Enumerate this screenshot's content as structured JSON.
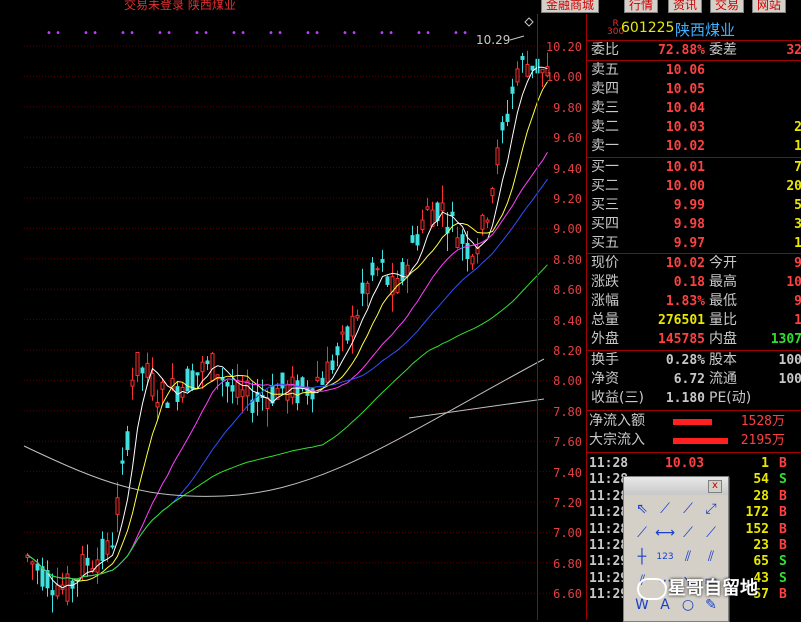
{
  "topbar": {
    "status_text": "交易未登录  陕西煤业",
    "buttons": [
      "金融商城",
      "行情",
      "资讯",
      "交易",
      "网站"
    ]
  },
  "chart": {
    "price_axis": [
      "10.20",
      "10.00",
      "9.80",
      "9.60",
      "9.40",
      "9.20",
      "9.00",
      "8.80",
      "8.60",
      "8.40",
      "8.20",
      "8.00",
      "7.80",
      "7.60",
      "7.40",
      "7.20",
      "7.00",
      "6.80",
      "6.60"
    ],
    "high_marker": "10.29",
    "colors": {
      "up": "#ff3030",
      "down": "#40e0e0",
      "ma5": "#ffffff",
      "ma10": "#ffff40",
      "ma20": "#ff40ff",
      "ma30": "#3050ff",
      "ma60": "#30e030",
      "ma120": "#c0c0c0"
    }
  },
  "quote": {
    "badge_r": "R",
    "badge_300": "300",
    "code": "601225",
    "name": "陕西煤业",
    "wei_bi_label": "委比",
    "wei_bi": "72.88%",
    "wei_cha_label": "委差",
    "wei_cha": "32",
    "asks": [
      {
        "label": "卖五",
        "price": "10.06",
        "vol": ""
      },
      {
        "label": "卖四",
        "price": "10.05",
        "vol": ""
      },
      {
        "label": "卖三",
        "price": "10.04",
        "vol": ""
      },
      {
        "label": "卖二",
        "price": "10.03",
        "vol": "2"
      },
      {
        "label": "卖一",
        "price": "10.02",
        "vol": "1"
      }
    ],
    "bids": [
      {
        "label": "买一",
        "price": "10.01",
        "vol": "7"
      },
      {
        "label": "买二",
        "price": "10.00",
        "vol": "20"
      },
      {
        "label": "买三",
        "price": "9.99",
        "vol": "5"
      },
      {
        "label": "买四",
        "price": "9.98",
        "vol": "3"
      },
      {
        "label": "买五",
        "price": "9.97",
        "vol": "1"
      }
    ],
    "stats": [
      {
        "l1": "现价",
        "v1": "10.02",
        "c1": "red",
        "l2": "今开",
        "v2": "9",
        "c2": "red"
      },
      {
        "l1": "涨跌",
        "v1": "0.18",
        "c1": "red",
        "l2": "最高",
        "v2": "10",
        "c2": "red"
      },
      {
        "l1": "涨幅",
        "v1": "1.83%",
        "c1": "red",
        "l2": "最低",
        "v2": "9",
        "c2": "red"
      },
      {
        "l1": "总量",
        "v1": "276501",
        "c1": "yel",
        "l2": "量比",
        "v2": "1",
        "c2": "red"
      },
      {
        "l1": "外盘",
        "v1": "145785",
        "c1": "red",
        "l2": "内盘",
        "v2": "1307",
        "c2": "grn"
      }
    ],
    "stats2": [
      {
        "l1": "换手",
        "v1": "0.28%",
        "l2": "股本",
        "v2": "100"
      },
      {
        "l1": "净资",
        "v1": "6.72",
        "l2": "流通",
        "v2": "100"
      },
      {
        "l1": "收益(三)",
        "v1": "1.180",
        "l2": "PE(动)",
        "v2": ""
      }
    ],
    "flows": [
      {
        "label": "净流入额",
        "value": "1528万",
        "bar": 0.55
      },
      {
        "label": "大宗流入",
        "value": "2195万",
        "bar": 0.78
      }
    ],
    "ticks": [
      {
        "time": "11:28",
        "price": "10.03",
        "vol": "1",
        "side": "B"
      },
      {
        "time": "11:28",
        "price": "",
        "vol": "54",
        "side": "S"
      },
      {
        "time": "11:28",
        "price": "",
        "vol": "28",
        "side": "B"
      },
      {
        "time": "11:28",
        "price": "",
        "vol": "172",
        "side": "B"
      },
      {
        "time": "11:28",
        "price": "",
        "vol": "152",
        "side": "B"
      },
      {
        "time": "11:28",
        "price": "",
        "vol": "23",
        "side": "B"
      },
      {
        "time": "11:29",
        "price": "",
        "vol": "65",
        "side": "S"
      },
      {
        "time": "11:29",
        "price": "",
        "vol": "43",
        "side": "S"
      },
      {
        "time": "11:29",
        "price": "",
        "vol": "57",
        "side": "B"
      }
    ]
  },
  "toolbox": {
    "tools": [
      "cursor-tool",
      "line-tool",
      "ray-tool",
      "segment-tool",
      "line-tool-2",
      "horizontal-line-tool",
      "arrow-tool",
      "arrow-tool-2",
      "vertical-line-tool",
      "number-tool",
      "parallel-tool",
      "parallel-tool-2",
      "fib-tool",
      "dot-line-tool",
      "angle-tool",
      "rect-tool",
      "wave-tool",
      "text-tool",
      "circle-tool",
      "pen-tool"
    ],
    "glyphs": [
      "⇖",
      "⟋",
      "⟋",
      "⤢",
      "⟋",
      "⟷",
      "⟋",
      "⟋",
      "┼",
      "123",
      "⫽",
      "⫽",
      "⫽",
      "⋯",
      "↘",
      "▭",
      "W",
      "A",
      "○",
      "✎"
    ],
    "close": "x"
  },
  "watermark": "星哥自留地"
}
